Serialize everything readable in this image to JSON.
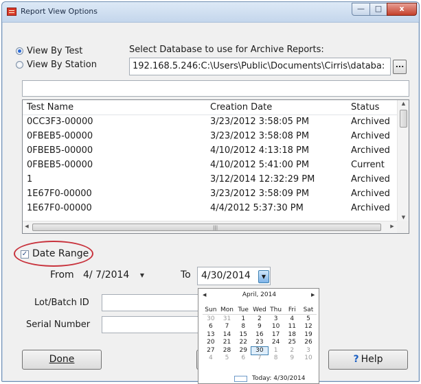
{
  "window": {
    "title": "Report View Options"
  },
  "title_buttons": {
    "minimize": "—",
    "maximize": "□",
    "close": "x"
  },
  "view_options": [
    {
      "label": "View By Test",
      "checked": true
    },
    {
      "label": "View By Station",
      "checked": false
    }
  ],
  "database": {
    "label": "Select Database to use for Archive Reports:",
    "path": "192.168.5.246:C:\\Users\\Public\\Documents\\Cirris\\databa:",
    "browse": "..."
  },
  "filter_box": {
    "value": ""
  },
  "table": {
    "columns": [
      "Test Name",
      "Creation Date",
      "Status"
    ],
    "rows": [
      [
        "0CC3F3-00000",
        "3/23/2012 3:58:05 PM",
        "Archived"
      ],
      [
        "0FBEB5-00000",
        "3/23/2012 3:58:08 PM",
        "Archived"
      ],
      [
        "0FBEB5-00000",
        "4/10/2012 4:13:18 PM",
        "Archived"
      ],
      [
        "0FBEB5-00000",
        "4/10/2012 5:41:00 PM",
        "Current"
      ],
      [
        "1",
        "3/12/2014 12:32:29 PM",
        "Archived"
      ],
      [
        "1E67F0-00000",
        "3/23/2012 3:58:09 PM",
        "Archived"
      ],
      [
        "1E67F0-00000",
        "4/4/2012 5:37:30 PM",
        "Archived"
      ]
    ]
  },
  "date_range": {
    "label": "Date Range",
    "checked": true,
    "from_label": "From",
    "from_value": "4/ 7/2014",
    "to_label": "To",
    "to_value": "4/30/2014"
  },
  "fields": {
    "lot_label": "Lot/Batch ID",
    "lot_value": "",
    "serial_label": "Serial Number",
    "serial_value": ""
  },
  "buttons": {
    "done": "Done",
    "help": "Help",
    "middle": ""
  },
  "calendar": {
    "month": "April, 2014",
    "days_of_week": [
      "Sun",
      "Mon",
      "Tue",
      "Wed",
      "Thu",
      "Fri",
      "Sat"
    ],
    "weeks": [
      [
        "30",
        "31",
        "1",
        "2",
        "3",
        "4",
        "5"
      ],
      [
        "6",
        "7",
        "8",
        "9",
        "10",
        "11",
        "12"
      ],
      [
        "13",
        "14",
        "15",
        "16",
        "17",
        "18",
        "19"
      ],
      [
        "20",
        "21",
        "22",
        "23",
        "24",
        "25",
        "26"
      ],
      [
        "27",
        "28",
        "29",
        "30",
        "1",
        "2",
        "3"
      ],
      [
        "4",
        "5",
        "6",
        "7",
        "8",
        "9",
        "10"
      ]
    ],
    "selected_day": "30",
    "today": "Today: 4/30/2014"
  },
  "colors": {
    "highlight_ellipse": "#c8323c",
    "close_button": "#c4402b",
    "selection": "#3c7fb1"
  }
}
